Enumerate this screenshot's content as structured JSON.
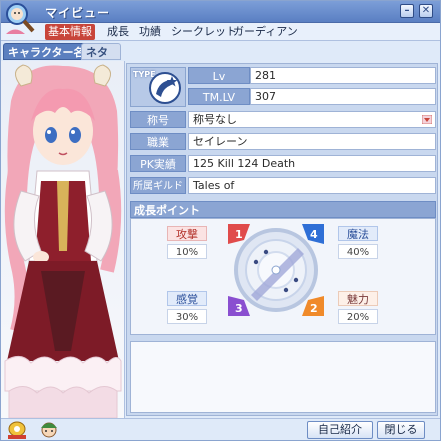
{
  "window": {
    "title": "マイビュー"
  },
  "menu": {
    "tabs": [
      "基本情報",
      "成長",
      "功績",
      "シークレット",
      "ガーディアン"
    ]
  },
  "subtabs": [
    "キャラクター名",
    "ネタット"
  ],
  "type_box": {
    "label": "TYPE"
  },
  "profile": {
    "lv_label": "Lv",
    "lv_value": "281",
    "tmlv_label": "TM.LV",
    "tmlv_value": "307",
    "title_label": "称号",
    "title_value": "称号なし",
    "job_label": "職業",
    "job_value": "セイレーン",
    "pk_label": "PK実績",
    "pk_value": "125 Kill  124 Death",
    "guild_label": "所属ギルド",
    "guild_value": "Tales of"
  },
  "growth": {
    "header": "成長ポイント",
    "stats": [
      {
        "name": "攻撃",
        "value": "10%",
        "marker": "1"
      },
      {
        "name": "魔法",
        "value": "40%",
        "marker": "4"
      },
      {
        "name": "感覚",
        "value": "30%",
        "marker": "3"
      },
      {
        "name": "魅力",
        "value": "20%",
        "marker": "2"
      }
    ]
  },
  "buttons": {
    "intro": "自己紹介",
    "close": "閉じる"
  },
  "icons": {
    "app": "magnifier-character-icon",
    "minimize": "minimize-icon",
    "close": "close-icon",
    "type": "star-tag-icon"
  },
  "colors": {
    "title_bar": "#5a7fc2",
    "active_tab": "#c8453a",
    "label_bg": "#8ba5d3",
    "panel_bg": "#c9d8ef"
  }
}
